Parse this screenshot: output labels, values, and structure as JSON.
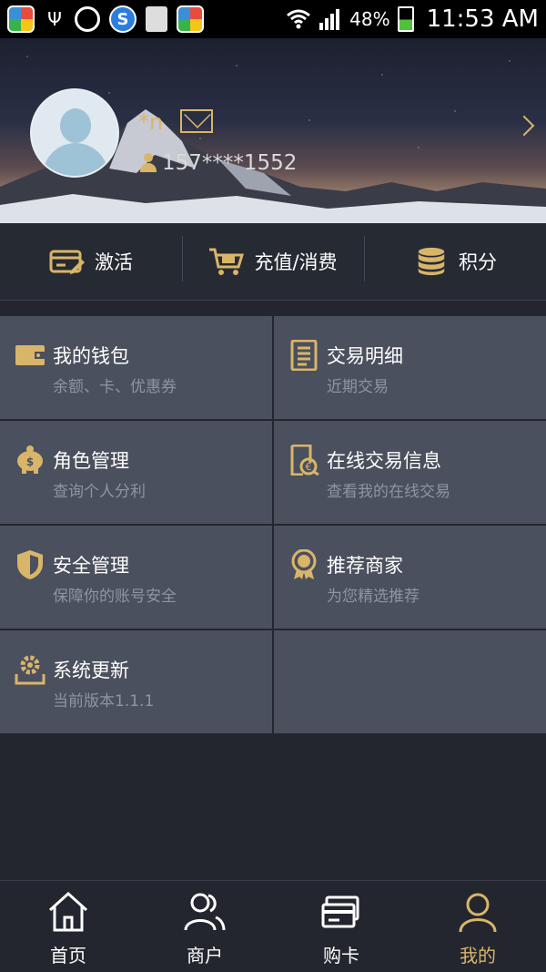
{
  "status_bar": {
    "battery": "48%",
    "time": "11:53 AM"
  },
  "profile": {
    "username": "*n",
    "phone": "157****1552"
  },
  "quick_actions": [
    {
      "label": "激活",
      "icon": "card-edit-icon"
    },
    {
      "label": "充值/消费",
      "icon": "shopping-cart-icon"
    },
    {
      "label": "积分",
      "icon": "coins-stack-icon"
    }
  ],
  "menu": [
    {
      "title": "我的钱包",
      "subtitle": "余额、卡、优惠券",
      "icon": "wallet-icon"
    },
    {
      "title": "交易明细",
      "subtitle": "近期交易",
      "icon": "document-list-icon"
    },
    {
      "title": "角色管理",
      "subtitle": "查询个人分利",
      "icon": "piggy-bank-icon"
    },
    {
      "title": "在线交易信息",
      "subtitle": "查看我的在线交易",
      "icon": "receipt-icon"
    },
    {
      "title": "安全管理",
      "subtitle": "保障你的账号安全",
      "icon": "shield-icon"
    },
    {
      "title": "推荐商家",
      "subtitle": "为您精选推荐",
      "icon": "best-badge-icon"
    },
    {
      "title": "系统更新",
      "subtitle": "当前版本1.1.1",
      "icon": "settings-update-icon"
    }
  ],
  "bottom_nav": [
    {
      "label": "首页",
      "icon": "home-icon"
    },
    {
      "label": "商户",
      "icon": "merchants-icon"
    },
    {
      "label": "购卡",
      "icon": "card-icon"
    },
    {
      "label": "我的",
      "icon": "profile-icon",
      "active": true
    }
  ],
  "colors": {
    "accent_gold": "#d9b56a",
    "cell_bg": "#4a505d",
    "page_bg": "#23262e"
  }
}
